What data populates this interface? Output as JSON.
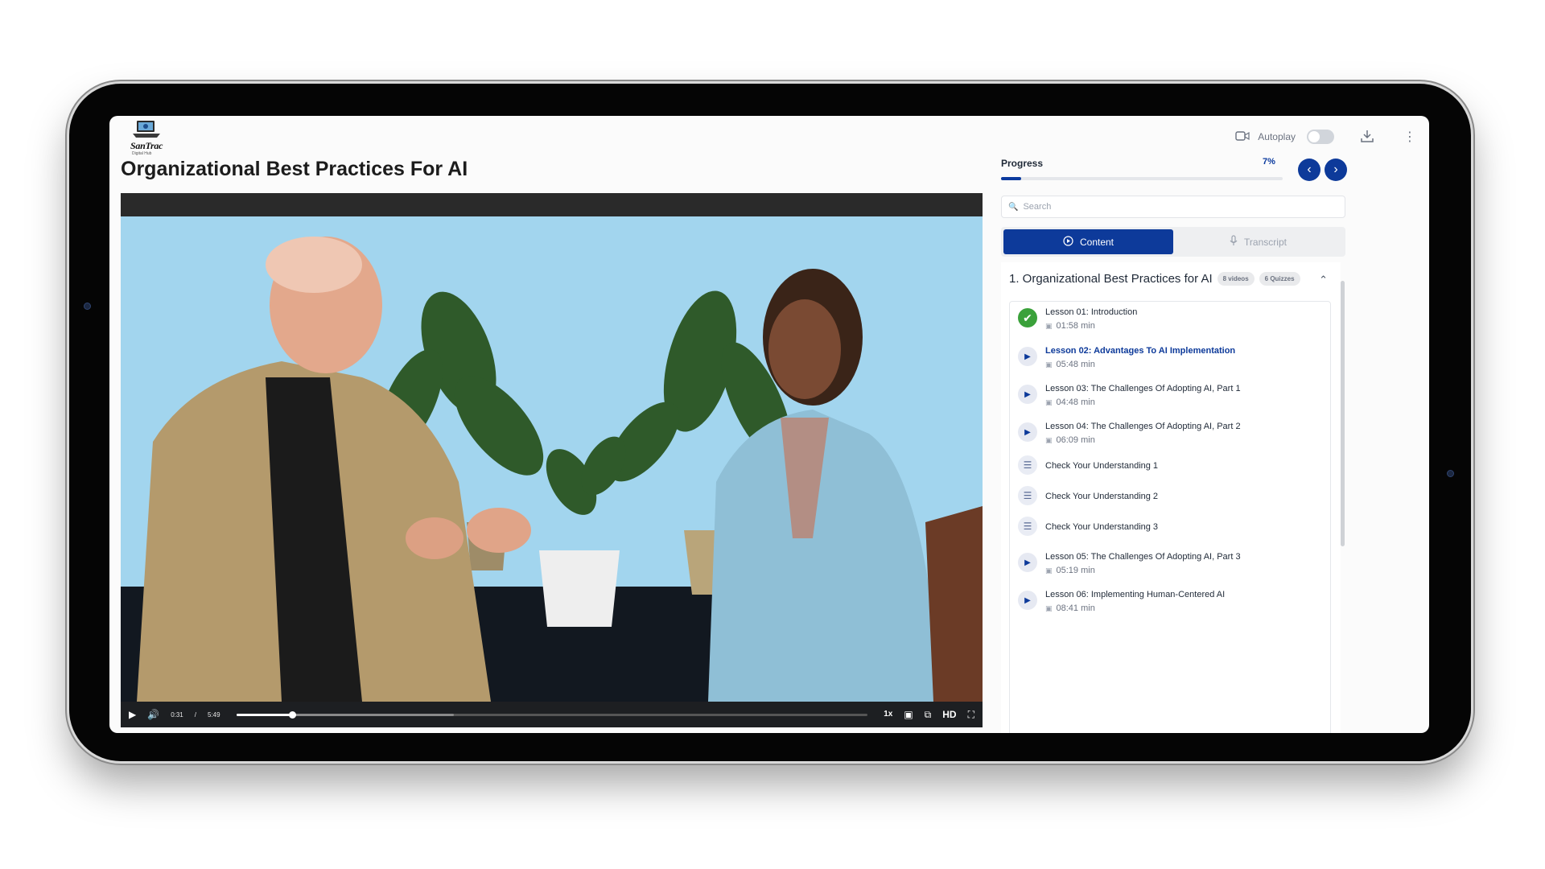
{
  "course": {
    "title": "Organizational Best Practices For AI",
    "logo_name": "SanTrac",
    "logo_sub": "Digital Hub"
  },
  "player": {
    "current_time": "0:31",
    "time_sep": "/",
    "duration": "5:49",
    "played_fraction": 0.089,
    "buffered_fraction": 0.345,
    "speed": "1x",
    "quality": "HD"
  },
  "toolbar": {
    "autoplay_label": "Autoplay",
    "autoplay_on": false
  },
  "progress": {
    "label": "Progress",
    "percent_text": "7%",
    "fraction": 0.07
  },
  "search": {
    "placeholder": "Search"
  },
  "tabs": [
    {
      "label": "Content",
      "active": true
    },
    {
      "label": "Transcript",
      "active": false
    }
  ],
  "section": {
    "title": "1. Organizational Best Practices for AI",
    "videos_badge": "8 videos",
    "quizzes_badge": "6 Quizzes"
  },
  "lessons": [
    {
      "type": "video",
      "status": "done",
      "title": "Lesson 01: Introduction",
      "duration": "01:58 min"
    },
    {
      "type": "video",
      "status": "current",
      "title": "Lesson 02: Advantages To AI Implementation",
      "duration": "05:48 min"
    },
    {
      "type": "video",
      "status": "todo",
      "title": "Lesson 03: The Challenges Of Adopting AI, Part 1",
      "duration": "04:48 min"
    },
    {
      "type": "video",
      "status": "todo",
      "title": "Lesson 04: The Challenges Of Adopting AI, Part 2",
      "duration": "06:09 min"
    },
    {
      "type": "quiz",
      "status": "todo",
      "title": "Check Your Understanding 1",
      "duration": ""
    },
    {
      "type": "quiz",
      "status": "todo",
      "title": "Check Your Understanding 2",
      "duration": ""
    },
    {
      "type": "quiz",
      "status": "todo",
      "title": "Check Your Understanding 3",
      "duration": ""
    },
    {
      "type": "video",
      "status": "todo",
      "title": "Lesson 05: The Challenges Of Adopting AI, Part 3",
      "duration": "05:19 min"
    },
    {
      "type": "video",
      "status": "todo",
      "title": "Lesson 06: Implementing Human-Centered AI",
      "duration": "08:41 min"
    }
  ],
  "colors": {
    "brand_blue": "#0d3a9a",
    "done_green": "#3aa13a"
  }
}
